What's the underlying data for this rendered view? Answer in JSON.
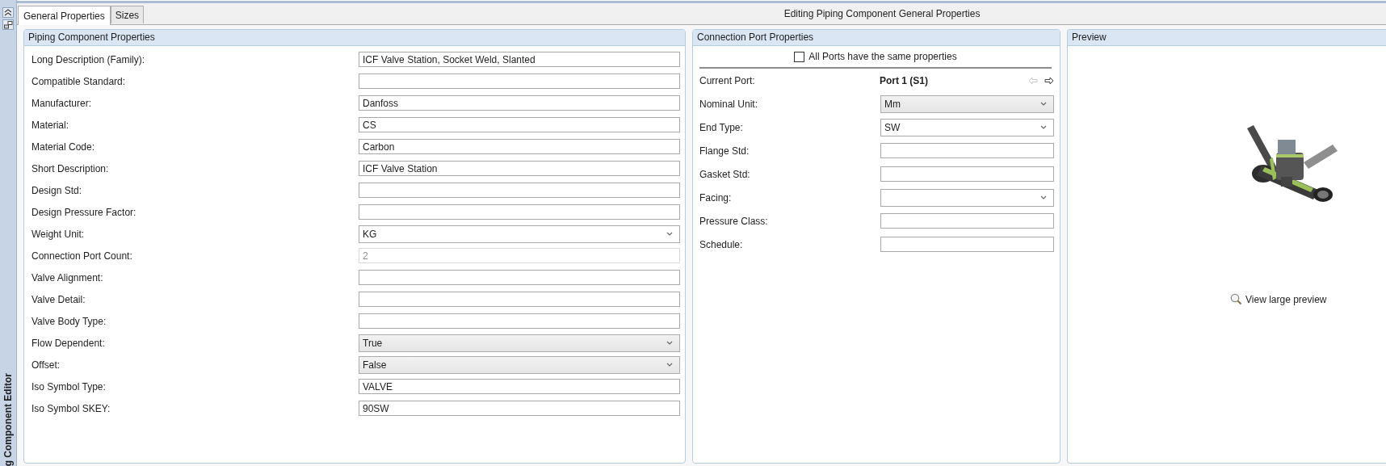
{
  "sidebar": {
    "title": "g Component Editor"
  },
  "tabs": [
    {
      "label": "General Properties",
      "selected": true
    },
    {
      "label": "Sizes",
      "selected": false
    }
  ],
  "header": {
    "title": "Editing Piping Component General Properties"
  },
  "piping_properties": {
    "title": "Piping Component Properties",
    "fields": [
      {
        "label": "Long Description (Family):",
        "kind": "text",
        "value": "ICF Valve Station, Socket Weld, Slanted"
      },
      {
        "label": "Compatible Standard:",
        "kind": "text"
      },
      {
        "label": "Manufacturer:",
        "kind": "text",
        "value": "Danfoss"
      },
      {
        "label": "Material:",
        "kind": "text",
        "value": "CS"
      },
      {
        "label": "Material Code:",
        "kind": "text",
        "value": "Carbon"
      },
      {
        "label": "Short Description:",
        "kind": "text",
        "value": "ICF Valve Station"
      },
      {
        "label": "Design Std:",
        "kind": "text"
      },
      {
        "label": "Design Pressure Factor:",
        "kind": "text"
      },
      {
        "label": "Weight Unit:",
        "kind": "combo",
        "value": "KG"
      },
      {
        "label": "Connection Port Count:",
        "kind": "readonly",
        "value": "2"
      },
      {
        "label": "Valve Alignment:",
        "kind": "text"
      },
      {
        "label": "Valve Detail:",
        "kind": "text"
      },
      {
        "label": "Valve Body Type:",
        "kind": "text"
      },
      {
        "label": "Flow Dependent:",
        "kind": "dropdown",
        "value": "True"
      },
      {
        "label": "Offset:",
        "kind": "dropdown",
        "value": "False"
      },
      {
        "label": "Iso Symbol Type:",
        "kind": "text",
        "value": "VALVE"
      },
      {
        "label": "Iso Symbol SKEY:",
        "kind": "text",
        "value": "90SW"
      }
    ]
  },
  "connection_port": {
    "title": "Connection Port Properties",
    "same_properties": {
      "label": "All Ports have the same properties",
      "checked": false
    },
    "current_port": {
      "label": "Current Port:",
      "value": "Port 1 (S1)"
    },
    "nav": [
      {
        "kind": "previous",
        "disabled": true
      },
      {
        "kind": "next",
        "disabled": false
      }
    ],
    "fields": [
      {
        "label": "Nominal Unit:",
        "kind": "dropdown",
        "value": "Mm"
      },
      {
        "label": "End Type:",
        "kind": "combo",
        "value": "SW"
      },
      {
        "label": "Flange Std:",
        "kind": "text"
      },
      {
        "label": "Gasket Std:",
        "kind": "text"
      },
      {
        "label": "Facing:",
        "kind": "combo"
      },
      {
        "label": "Pressure Class:",
        "kind": "text"
      },
      {
        "label": "Schedule:",
        "kind": "text"
      }
    ]
  },
  "preview": {
    "title": "Preview",
    "kind": "picture",
    "link": "View large preview"
  }
}
